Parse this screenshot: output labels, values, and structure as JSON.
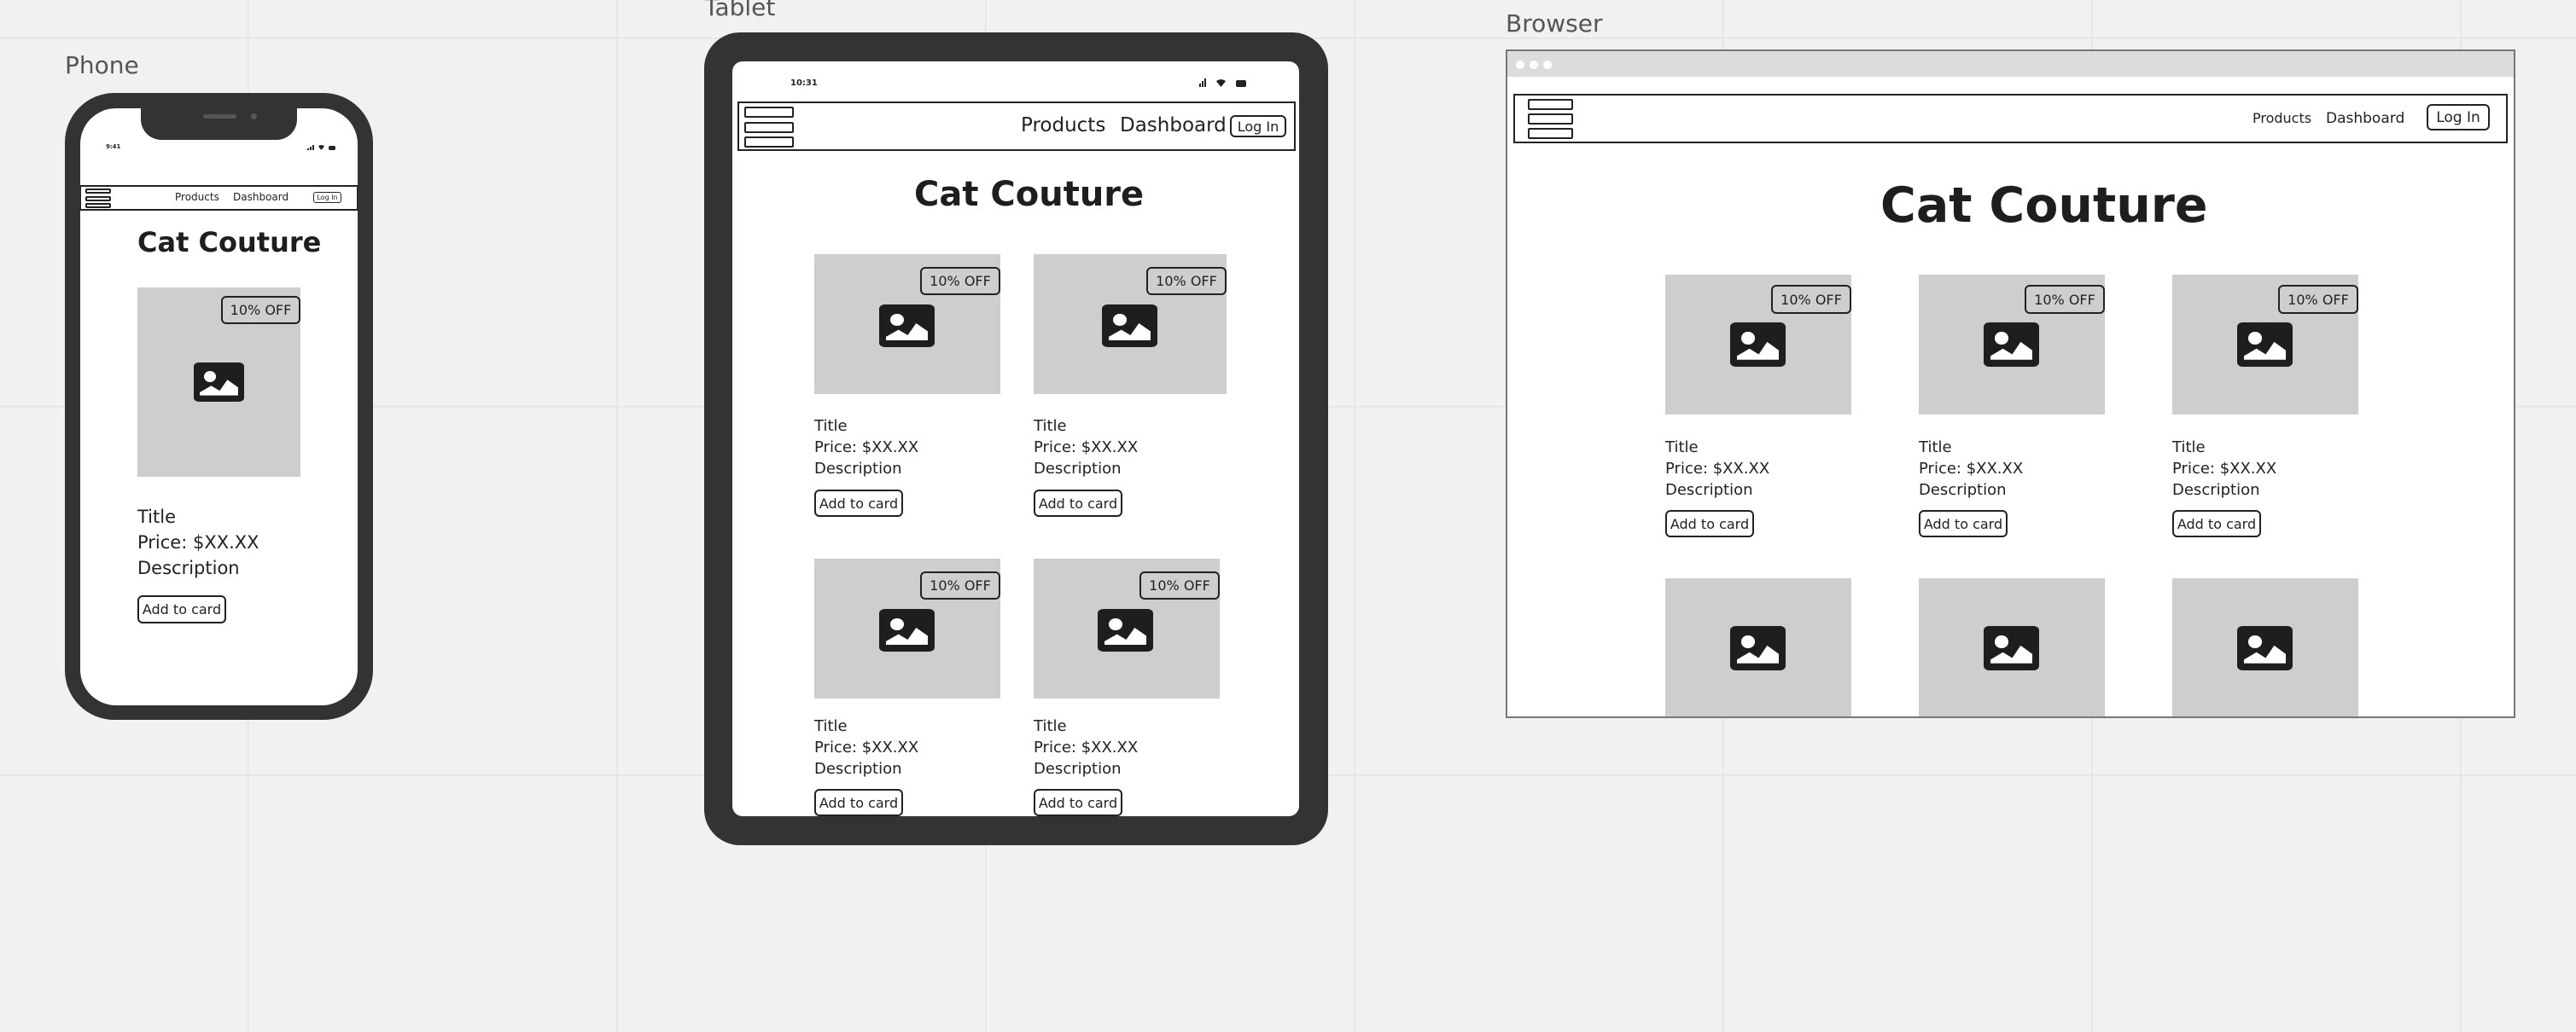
{
  "frames": {
    "phone": "Phone",
    "tablet": "Tablet",
    "browser": "Browser"
  },
  "status": {
    "phone_time": "9:41",
    "tablet_time": "10:31"
  },
  "nav": {
    "products": "Products",
    "dashboard": "Dashboard",
    "login": "Log In"
  },
  "heading": "Cat Couture",
  "product": {
    "badge": "10% OFF",
    "title": "Title",
    "price": "Price: $XX.XX",
    "description": "Description",
    "cta": "Add to card"
  },
  "icons": {
    "menu": "hamburger-menu-icon",
    "image": "image-placeholder-icon",
    "signal": "signal-icon",
    "wifi": "wifi-icon",
    "battery": "battery-icon"
  },
  "colors": {
    "device_shell": "#333333",
    "placeholder": "#cecece",
    "canvas": "#f1f1f1"
  }
}
